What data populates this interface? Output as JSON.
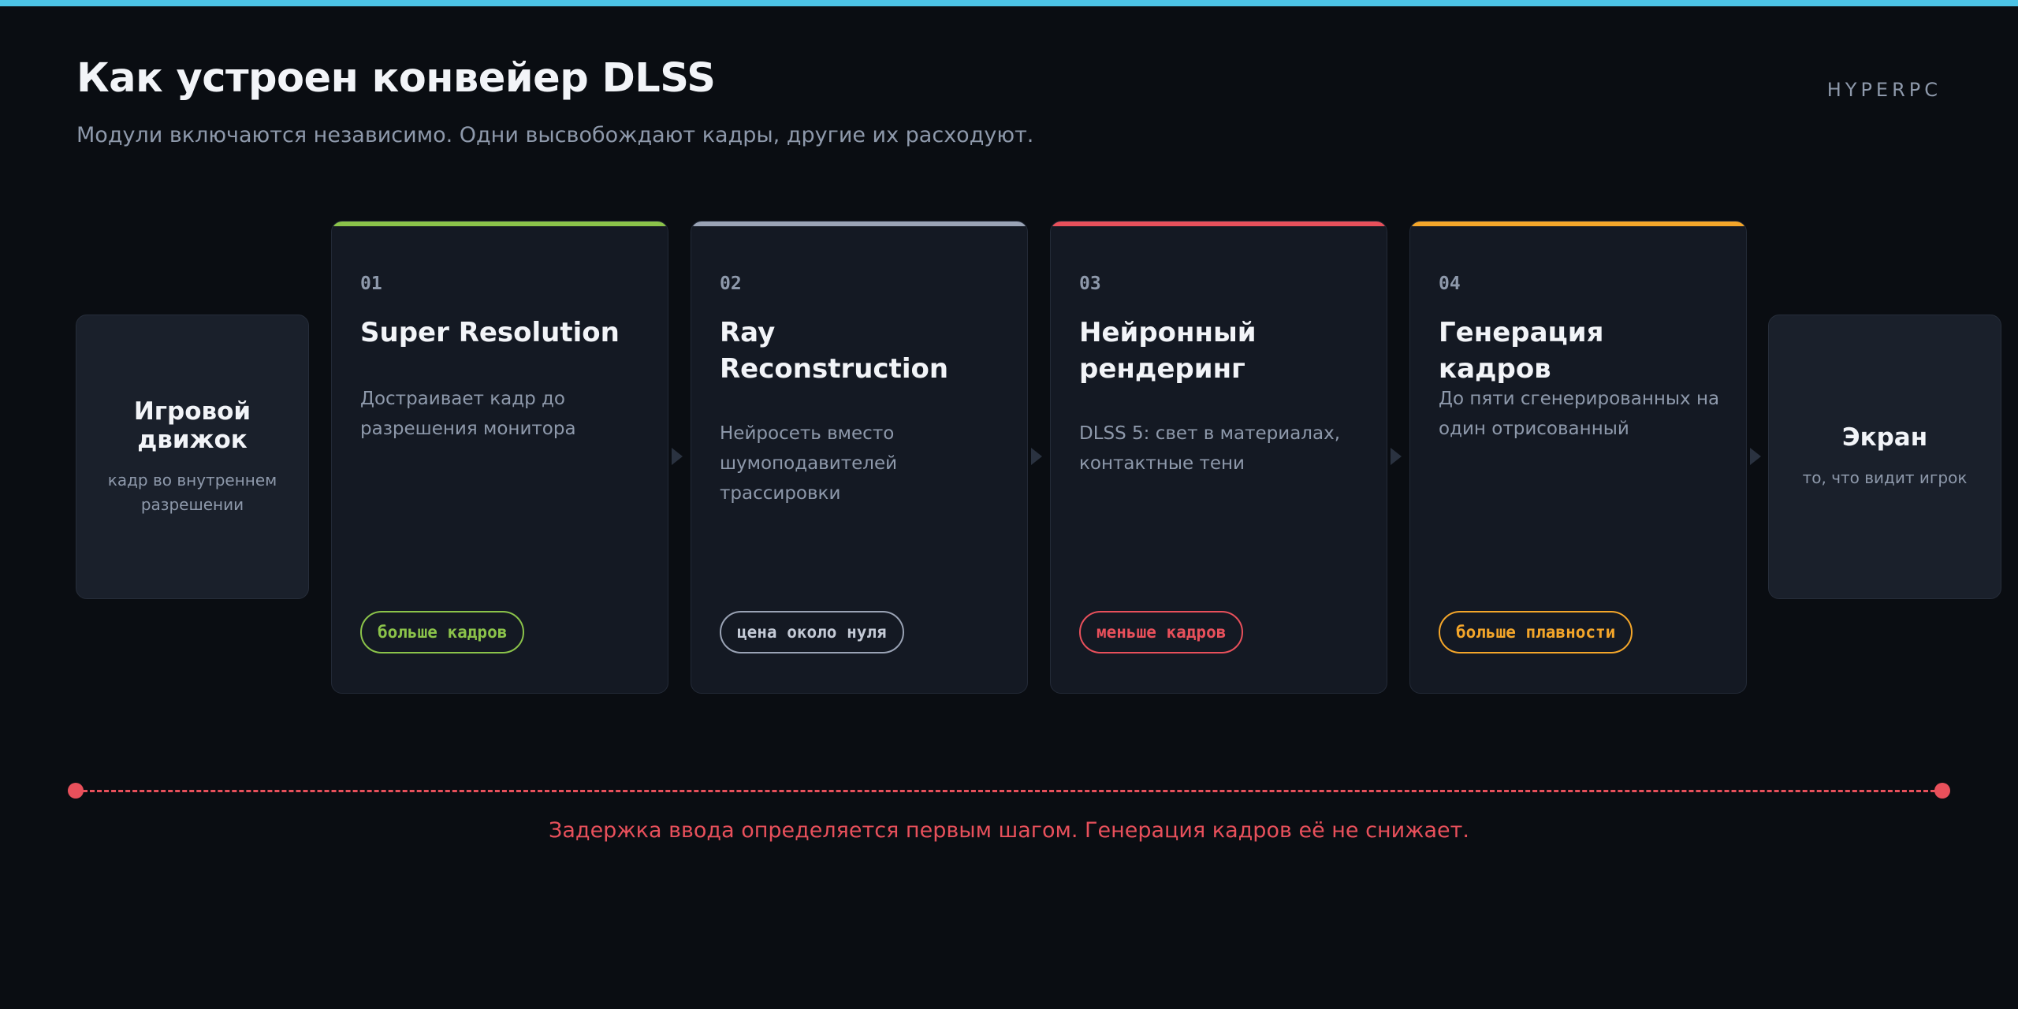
{
  "header": {
    "title": "Как устроен конвейер DLSS",
    "subtitle": "Модули включаются независимо. Одни высвобождают кадры, другие их расходуют.",
    "brand": "HYPERPC"
  },
  "pipeline": {
    "input": {
      "title": "Игровой движок",
      "subtitle": "кадр во внутреннем разрешении"
    },
    "stages": [
      {
        "number": "01",
        "title": "Super Resolution",
        "description": "Достраивает кадр до разрешения монитора",
        "tag": "больше кадров",
        "color": "#8bc34a"
      },
      {
        "number": "02",
        "title": "Ray Reconstruction",
        "description": "Нейросеть вместо шумоподавителей трассировки",
        "tag": "цена около нуля",
        "color": "#9aa3b5"
      },
      {
        "number": "03",
        "title": "Нейронный рендеринг",
        "description": "DLSS 5: свет в материалах, контактные тени",
        "tag": "меньше кадров",
        "color": "#e8505b"
      },
      {
        "number": "04",
        "title": "Генерация кадров",
        "description": "До пяти сгенерированных на один отрисованный",
        "tag": "больше плавности",
        "color": "#f4a62a"
      }
    ],
    "output": {
      "title": "Экран",
      "subtitle": "то, что видит игрок"
    }
  },
  "latency_note": "Задержка ввода определяется первым шагом. Генерация кадров её не снижает.",
  "colors": {
    "top_bar": "#4cc3e6",
    "background": "#0a0d12",
    "latency": "#e8505b"
  }
}
